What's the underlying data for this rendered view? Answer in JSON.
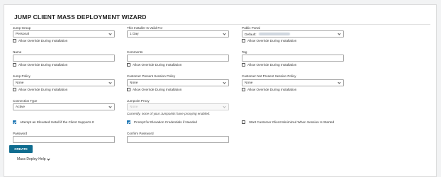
{
  "wizard": {
    "title": "JUMP CLIENT MASS DEPLOYMENT WIZARD"
  },
  "override_label": "Allow Override During Installation",
  "jump_group": {
    "label": "Jump Group",
    "value": "Personal"
  },
  "installer_valid": {
    "label": "This Installer Is Valid For",
    "value": "1 Day"
  },
  "public_portal": {
    "label": "Public Portal",
    "value": "Default:"
  },
  "name": {
    "label": "Name",
    "value": ""
  },
  "comments": {
    "label": "Comments",
    "value": ""
  },
  "tag": {
    "label": "Tag",
    "value": ""
  },
  "jump_policy": {
    "label": "Jump Policy",
    "value": "None"
  },
  "customer_present_policy": {
    "label": "Customer Present Session Policy",
    "value": "None"
  },
  "customer_not_present_policy": {
    "label": "Customer Not Present Session Policy",
    "value": "None"
  },
  "connection_type": {
    "label": "Connection Type",
    "value": "Active"
  },
  "jumppoint_proxy": {
    "label": "Jumpoint Proxy",
    "value": "None",
    "note": "Currently, none of your Jumpoints have proxying enabled."
  },
  "options": {
    "elevated_install": {
      "label": "Attempt an Elevated Install if the Client Supports It",
      "checked": true
    },
    "prompt_elevation": {
      "label": "Prompt for Elevation Credentials if Needed",
      "checked": true
    },
    "start_minimized": {
      "label": "Start Customer Client Minimized When Session Is Started",
      "checked": false
    }
  },
  "password": {
    "label": "Password",
    "value": ""
  },
  "confirm_password": {
    "label": "Confirm Password",
    "value": ""
  },
  "create_button": "CREATE",
  "help_link": "Mass Deploy Help",
  "colors": {
    "accent": "#0f6c8f",
    "checkbox": "#1f77b4"
  }
}
